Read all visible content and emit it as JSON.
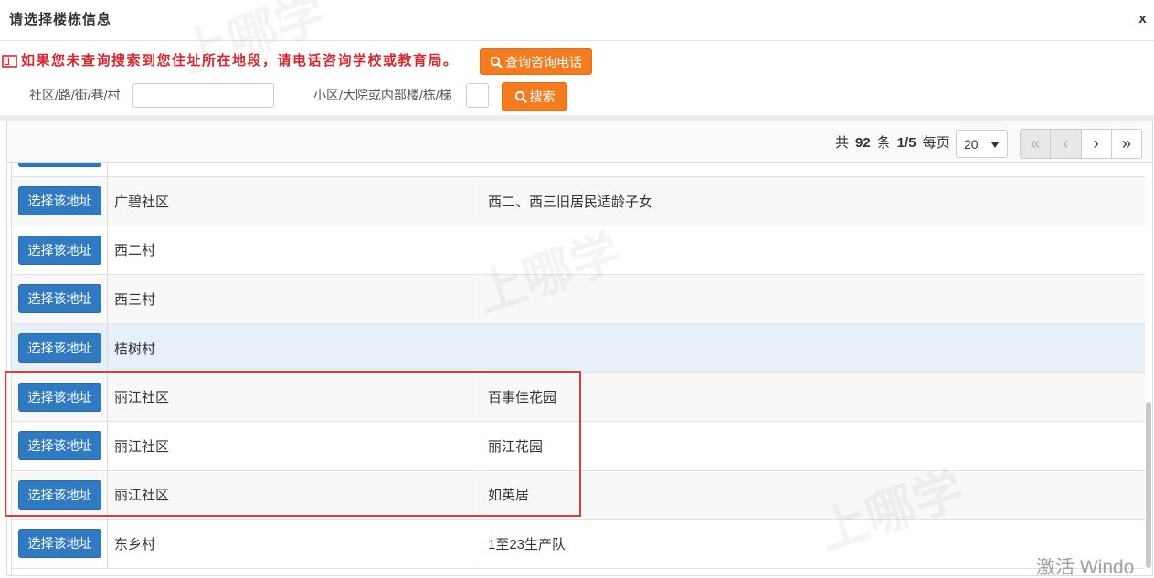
{
  "dialog": {
    "title": "请选择楼栋信息",
    "close_label": "x"
  },
  "notice": {
    "icon": "notice-icon",
    "text": "如果您未查询搜索到您住址所在地段，请电话咨询学校或教育局。",
    "phone_button_icon": "search-icon",
    "phone_button_label": "查询咨询电话"
  },
  "search": {
    "community_label": "社区/路/街/巷/村",
    "community_value": "",
    "building_label": "小区/大院或内部楼/栋/梯",
    "building_value": "",
    "search_button_icon": "search-icon",
    "search_button_label": "搜索"
  },
  "pagination": {
    "total_prefix": "共",
    "total_count": "92",
    "total_suffix": "条",
    "page_indicator": "1/5",
    "per_page_label": "每页",
    "per_page_value": "20",
    "first_glyph": "«",
    "prev_glyph": "‹",
    "next_glyph": "›",
    "last_glyph": "»"
  },
  "table": {
    "select_label": "选择该地址",
    "rows": [
      {
        "community": "广碧社区",
        "detail": "西二、西三旧居民适龄子女"
      },
      {
        "community": "西二村",
        "detail": ""
      },
      {
        "community": "西三村",
        "detail": ""
      },
      {
        "community": "桔树村",
        "detail": ""
      },
      {
        "community": "丽江社区",
        "detail": "百事佳花园"
      },
      {
        "community": "丽江社区",
        "detail": "丽江花园"
      },
      {
        "community": "丽江社区",
        "detail": "如英居"
      },
      {
        "community": "东乡村",
        "detail": "1至23生产队"
      }
    ]
  },
  "watermark": {
    "text": "上哪学"
  },
  "os_watermark": {
    "text": "激活 Windo"
  },
  "colors": {
    "orange": "#f47b20",
    "blue": "#2f7ac0",
    "red": "#d7282f",
    "highlight": "#e7f0f9",
    "annot": "#d8413a"
  }
}
